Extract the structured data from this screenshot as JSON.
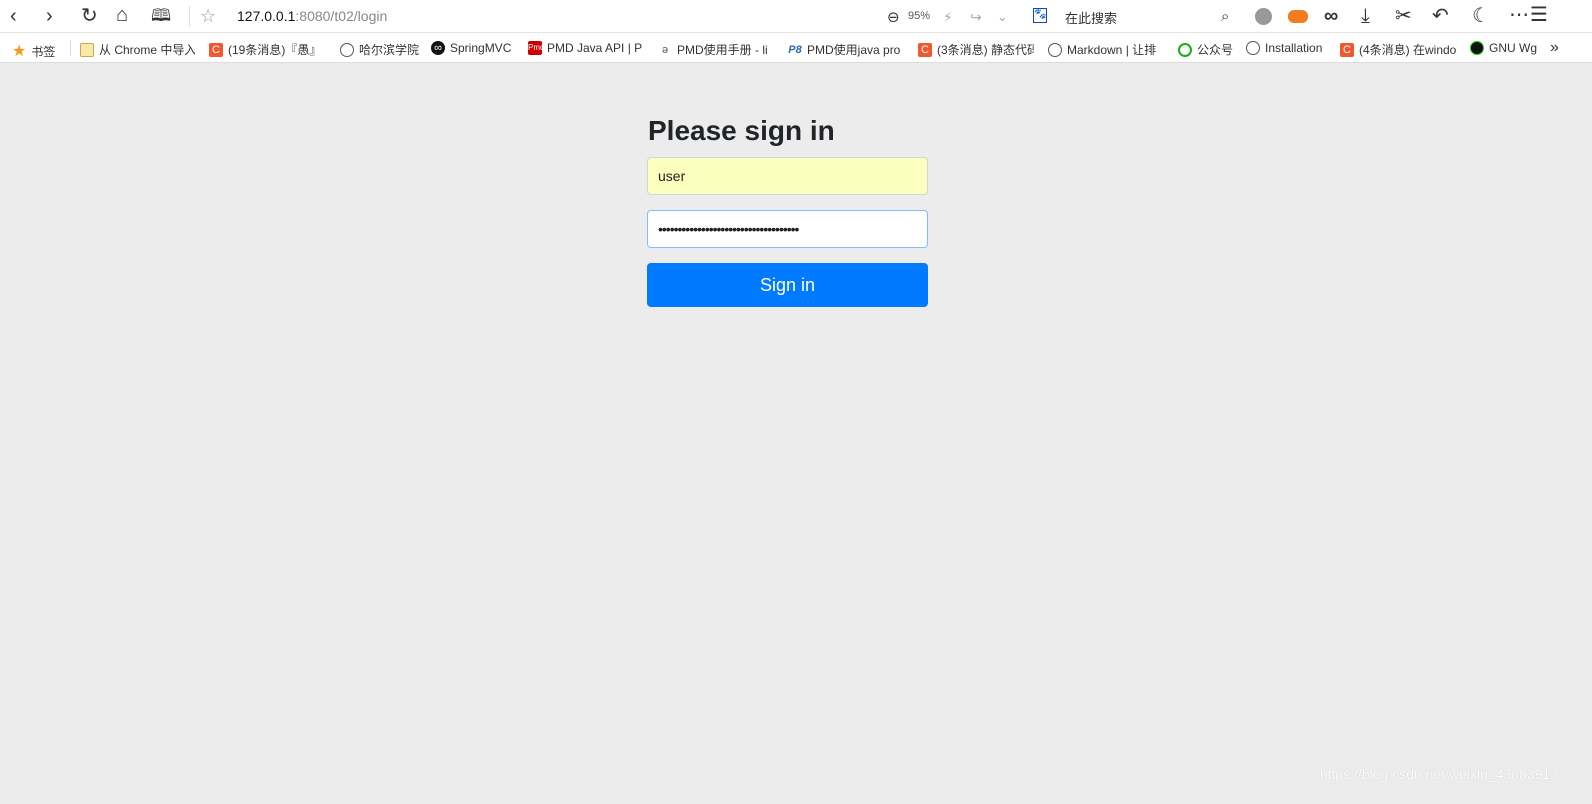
{
  "browser": {
    "url_host": "127.0.0.1",
    "url_rest": ":8080/t02/login",
    "zoom": "95%",
    "search_placeholder": "在此搜索"
  },
  "bookmarks": [
    {
      "label": "书签",
      "icon": "star-icon"
    },
    {
      "label": "从 Chrome 中导入",
      "icon": "folder-icon"
    },
    {
      "label": "(19条消息)『愚』",
      "icon": "csdn-icon"
    },
    {
      "label": "哈尔滨学院",
      "icon": "globe-icon"
    },
    {
      "label": "SpringMVC",
      "icon": "infinity-icon"
    },
    {
      "label": "PMD Java API | P",
      "icon": "pmd-icon"
    },
    {
      "label": "PMD使用手册 - li",
      "icon": "pmd-manual-icon"
    },
    {
      "label": "PMD使用java pro",
      "icon": "p8-icon"
    },
    {
      "label": "(3条消息) 静态代码",
      "icon": "csdn-icon"
    },
    {
      "label": "Markdown | 让排",
      "icon": "globe-icon"
    },
    {
      "label": "公众号",
      "icon": "wechat-icon"
    },
    {
      "label": "Installation",
      "icon": "globe-icon"
    },
    {
      "label": "(4条消息) 在windo",
      "icon": "csdn-icon"
    },
    {
      "label": "GNU Wg",
      "icon": "gnu-icon"
    }
  ],
  "form": {
    "title": "Please sign in",
    "username": "user",
    "password": "••••••••••••••••••••••••••••••••••••",
    "submit": "Sign in",
    "accent": "#007bff",
    "autofill_bg": "#faffbd"
  },
  "watermark": "https://blog.csdn.net/weixin_43883917"
}
